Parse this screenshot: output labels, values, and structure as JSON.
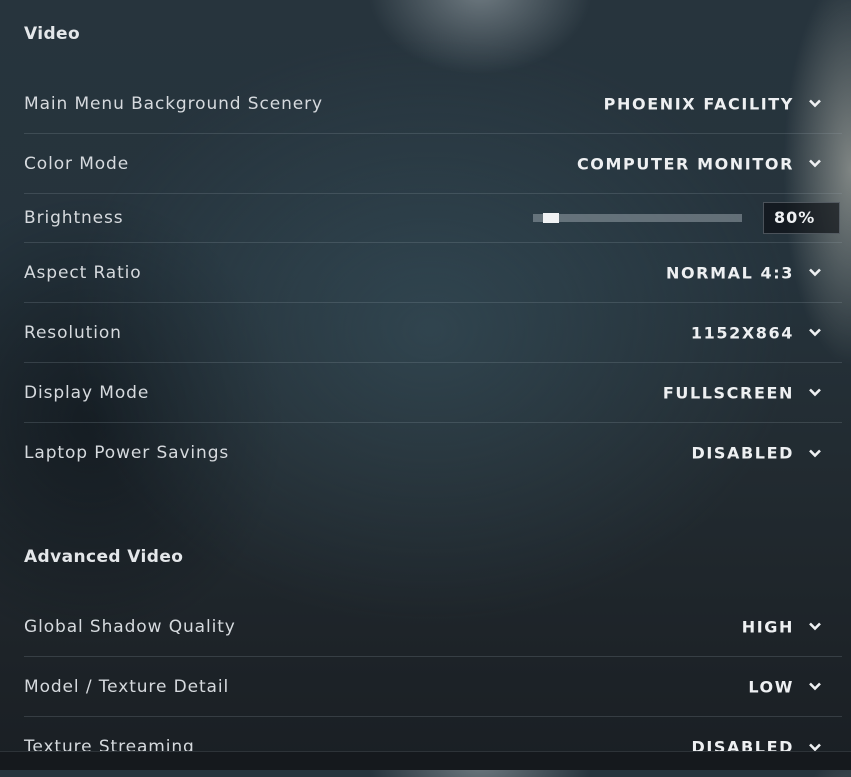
{
  "video": {
    "title": "Video",
    "rows": [
      {
        "label": "Main Menu Background Scenery",
        "value": "PHOENIX FACILITY"
      },
      {
        "label": "Color Mode",
        "value": "COMPUTER MONITOR"
      },
      {
        "label": "Brightness",
        "value": "80%",
        "slider_fraction": 0.05
      },
      {
        "label": "Aspect Ratio",
        "value": "NORMAL 4:3"
      },
      {
        "label": "Resolution",
        "value": "1152X864"
      },
      {
        "label": "Display Mode",
        "value": "FULLSCREEN"
      },
      {
        "label": "Laptop Power Savings",
        "value": "DISABLED"
      }
    ]
  },
  "advanced": {
    "title": "Advanced Video",
    "rows": [
      {
        "label": "Global Shadow Quality",
        "value": "HIGH"
      },
      {
        "label": "Model / Texture Detail",
        "value": "LOW"
      },
      {
        "label": "Texture Streaming",
        "value": "DISABLED"
      }
    ]
  },
  "icons": {
    "dropdown": "chevron-down-icon"
  },
  "colors": {
    "text": "#d6dade",
    "value": "#eef0f2",
    "divider": "#4a555c"
  }
}
